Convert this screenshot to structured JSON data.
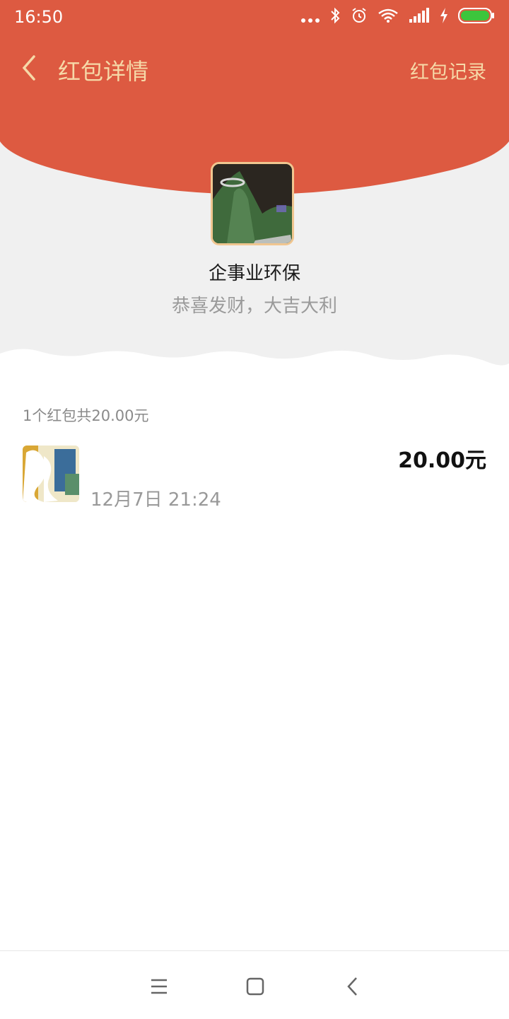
{
  "status_bar": {
    "time": "16:50",
    "icons": [
      "dots-icon",
      "bluetooth-icon",
      "alarm-icon",
      "wifi-icon",
      "signal-icon",
      "charging-icon",
      "battery-icon"
    ],
    "battery_color": "#3cc53c"
  },
  "header": {
    "title": "红包详情",
    "record_link": "红包记录",
    "bg_color": "#dd5a41",
    "accent_color": "#f6d9a8"
  },
  "sender": {
    "name": "企事业环保",
    "blessing": "恭喜发财，大吉大利"
  },
  "summary": "1个红包共20.00元",
  "receivers": [
    {
      "name": "",
      "time": "12月7日  21:24",
      "amount": "20.00元"
    }
  ],
  "bottom_nav": {
    "icons": [
      "menu-icon",
      "home-icon",
      "back-icon"
    ]
  }
}
